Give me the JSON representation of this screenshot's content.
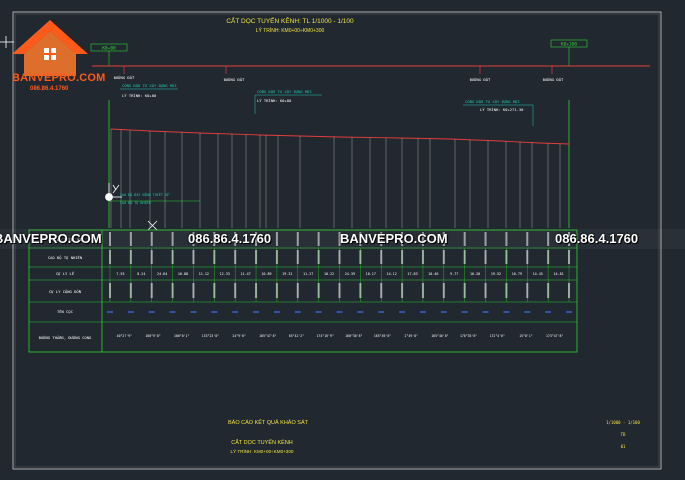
{
  "drawing": {
    "title": "CẮT DỌC TUYẾN KÊNH: TL 1/1000 - 1/100",
    "subtitle": "LÝ TRÌNH: KM0+00÷KM0+300",
    "start_marker": "K0+00",
    "end_marker": "K0+300",
    "road_labels": [
      "ĐƯỜNG ĐẤT",
      "ĐƯỜNG ĐẤT",
      "ĐƯỜNG ĐẤT",
      "ĐƯỜNG ĐẤT"
    ],
    "annotations": [
      {
        "line1": "CỐNG ĐẦU TƯ XÂY DỰNG MỚI",
        "line2": "LÝ TRÌNH: K0+00"
      },
      {
        "line1": "CỐNG ĐẦU TƯ XÂY DỰNG MỚI",
        "line2": "LÝ TRÌNH: K0+80"
      },
      {
        "line1": "CỐNG ĐẦU TƯ XÂY DỰNG MỚI",
        "line2": "LÝ TRÌNH: K0+271.30"
      }
    ],
    "small_notes": [
      "CAO ĐỘ ĐÁY KÊNH THIẾT KẾ",
      "CAO ĐỘ TỰ NHIÊN"
    ]
  },
  "table": {
    "row_labels": [
      "CAO ĐỘ THIẾT KẾ",
      "CAO ĐỘ TỰ NHIÊN",
      "CỰ LY LẺ",
      "CỰ LY CỘNG DỒN",
      "TÊN CỌC",
      "ĐƯỜNG THẲNG, ĐƯỜNG CONG"
    ],
    "distances": [
      "7.55",
      "8.24",
      "24.84",
      "16.88",
      "11.12",
      "12.33",
      "11.47",
      "10.89",
      "19.31",
      "11.27",
      "10.22",
      "24.39",
      "10.17",
      "14.12",
      "17.83",
      "10.46",
      "9.77",
      "16.28",
      "19.52",
      "10.79",
      "14.45",
      "14.81"
    ],
    "curves": [
      "40°27'9\"",
      "160°9'8\"",
      "100°0'1\"",
      "133°23'8\"",
      "24°9'6\"",
      "165°47'8\"",
      "65°42'2\"",
      "174°16'9\"",
      "160°30'8\"",
      "165°49'6\"",
      "2°49'8\"",
      "165°46'8\"",
      "170°35'6\"",
      "172°4'6\"",
      "15°8'1\"",
      "173°47'8\""
    ]
  },
  "footer": {
    "report_title": "BÁO CÁO KẾT QUẢ KHẢO SÁT",
    "drawing_name": "CẮT DỌC TUYẾN KÊNH",
    "station_range": "LÝ TRÌNH: KM0+00÷KM0+300",
    "scale": "1/1000 - 1/100",
    "sheet_code": "TD",
    "sheet_no": "01"
  },
  "brand": {
    "name": "BANVEPRO.COM",
    "phone": "086.86.4.1760",
    "watermarks": [
      "BANVEPRO.COM",
      "086.86.4.1760",
      "BANVEPRO.COM",
      "086.86.4.1760"
    ]
  },
  "colors": {
    "background": "#212830",
    "frame": "#d8d8d8",
    "table_green": "#2fd22f",
    "title_yellow": "#f0e442",
    "profile_red": "#e53c3c",
    "brand_orange": "#ff5a1a",
    "annotation_cyan": "#1ec8b4"
  }
}
